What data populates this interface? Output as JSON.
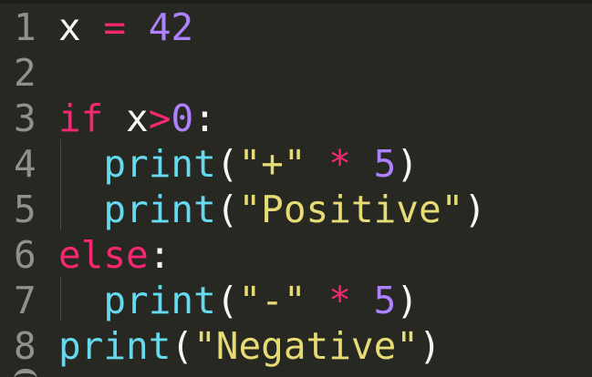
{
  "editor": {
    "theme_colors": {
      "background": "#272822",
      "gutter_text": "#909090",
      "plain": "#f8f8f2",
      "keyword": "#f92672",
      "number": "#ae81ff",
      "function": "#66d9ef",
      "string": "#e6db74"
    },
    "lines": [
      {
        "number": "1",
        "tokens": [
          {
            "text": "x ",
            "kind": "plain"
          },
          {
            "text": "=",
            "kind": "op"
          },
          {
            "text": " ",
            "kind": "plain"
          },
          {
            "text": "42",
            "kind": "num"
          }
        ]
      },
      {
        "number": "2",
        "tokens": []
      },
      {
        "number": "3",
        "tokens": [
          {
            "text": "if",
            "kind": "kw"
          },
          {
            "text": " x",
            "kind": "plain"
          },
          {
            "text": ">",
            "kind": "op"
          },
          {
            "text": "0",
            "kind": "num"
          },
          {
            "text": ":",
            "kind": "plain"
          }
        ]
      },
      {
        "number": "4",
        "tokens": [
          {
            "text": "  ",
            "kind": "plain"
          },
          {
            "text": "print",
            "kind": "fn"
          },
          {
            "text": "(",
            "kind": "plain"
          },
          {
            "text": "\"+\"",
            "kind": "str"
          },
          {
            "text": " ",
            "kind": "plain"
          },
          {
            "text": "*",
            "kind": "op"
          },
          {
            "text": " ",
            "kind": "plain"
          },
          {
            "text": "5",
            "kind": "num"
          },
          {
            "text": ")",
            "kind": "plain"
          }
        ]
      },
      {
        "number": "5",
        "tokens": [
          {
            "text": "  ",
            "kind": "plain"
          },
          {
            "text": "print",
            "kind": "fn"
          },
          {
            "text": "(",
            "kind": "plain"
          },
          {
            "text": "\"Positive\"",
            "kind": "str"
          },
          {
            "text": ")",
            "kind": "plain"
          }
        ]
      },
      {
        "number": "6",
        "tokens": [
          {
            "text": "else",
            "kind": "kw"
          },
          {
            "text": ":",
            "kind": "plain"
          }
        ]
      },
      {
        "number": "7",
        "tokens": [
          {
            "text": "  ",
            "kind": "plain"
          },
          {
            "text": "print",
            "kind": "fn"
          },
          {
            "text": "(",
            "kind": "plain"
          },
          {
            "text": "\"-\"",
            "kind": "str"
          },
          {
            "text": " ",
            "kind": "plain"
          },
          {
            "text": "*",
            "kind": "op"
          },
          {
            "text": " ",
            "kind": "plain"
          },
          {
            "text": "5",
            "kind": "num"
          },
          {
            "text": ")",
            "kind": "plain"
          }
        ]
      },
      {
        "number": "8",
        "tokens": [
          {
            "text": "print",
            "kind": "fn"
          },
          {
            "text": "(",
            "kind": "plain"
          },
          {
            "text": "\"Negative\"",
            "kind": "str"
          },
          {
            "text": ")",
            "kind": "plain"
          }
        ]
      }
    ]
  }
}
